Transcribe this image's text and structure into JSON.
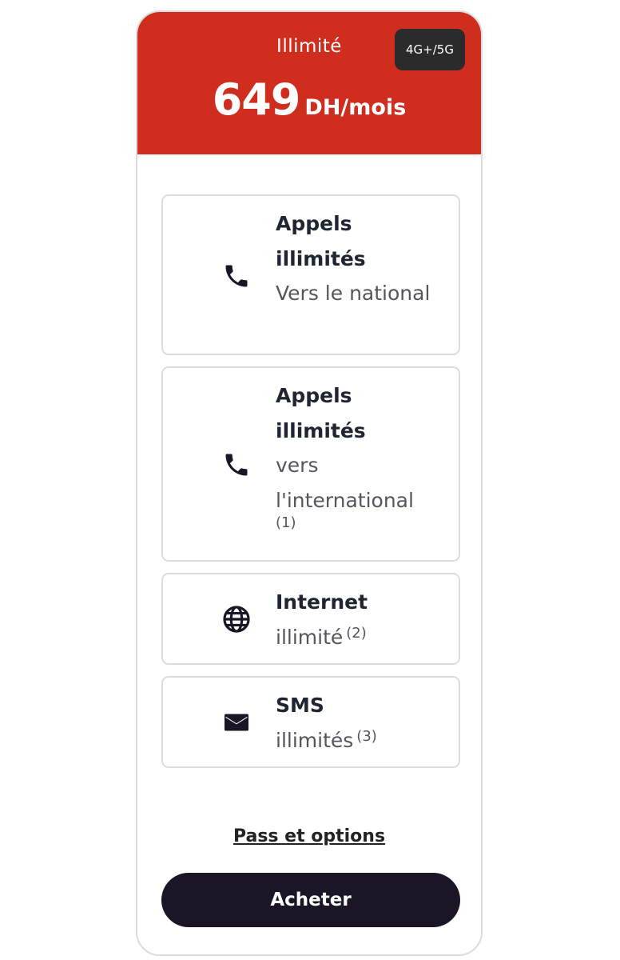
{
  "header": {
    "plan_name": "Illimité",
    "price_amount": "649",
    "price_unit": "DH/mois",
    "network_badge": "4G+/5G",
    "background_color": "#cf2d1e"
  },
  "features": [
    {
      "icon": "phone-icon",
      "title": "Appels illimités",
      "description": "Vers le national",
      "note": ""
    },
    {
      "icon": "phone-icon",
      "title": "Appels illimités",
      "description": "vers l'international",
      "note": "(1)"
    },
    {
      "icon": "globe-icon",
      "title": "Internet",
      "description": "illimité",
      "note": "(2)"
    },
    {
      "icon": "envelope-icon",
      "title": "SMS",
      "description": "illimités",
      "note": "(3)"
    }
  ],
  "footer": {
    "pass_link_label": "Pass et options",
    "buy_button_label": "Acheter",
    "button_color": "#1a1626"
  }
}
